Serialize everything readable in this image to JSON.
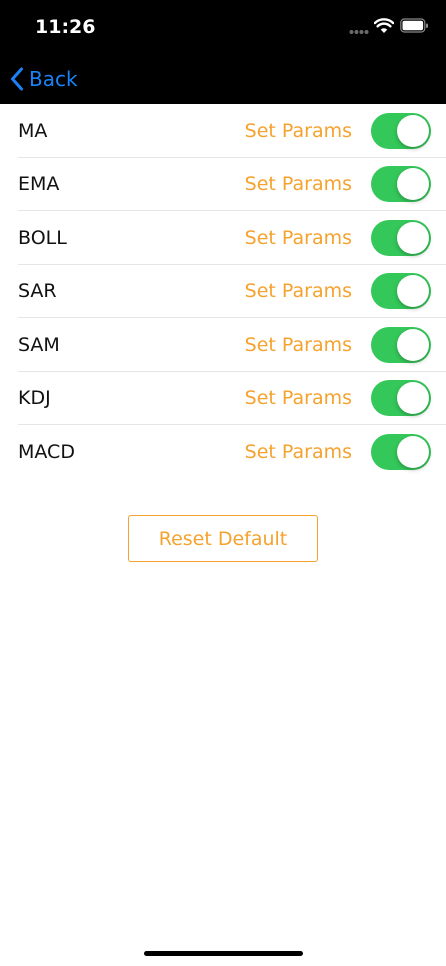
{
  "status_bar": {
    "time": "11:26"
  },
  "nav": {
    "back_label": "Back"
  },
  "indicators": [
    {
      "name": "MA",
      "action": "Set Params",
      "enabled": true
    },
    {
      "name": "EMA",
      "action": "Set Params",
      "enabled": true
    },
    {
      "name": "BOLL",
      "action": "Set Params",
      "enabled": true
    },
    {
      "name": "SAR",
      "action": "Set Params",
      "enabled": true
    },
    {
      "name": "SAM",
      "action": "Set Params",
      "enabled": true
    },
    {
      "name": "KDJ",
      "action": "Set Params",
      "enabled": true
    },
    {
      "name": "MACD",
      "action": "Set Params",
      "enabled": true
    }
  ],
  "reset_button": {
    "label": "Reset Default"
  },
  "colors": {
    "accent": "#f5a22e",
    "toggle_on": "#34c759",
    "back_link": "#1a82f7",
    "nav_background": "#000000"
  }
}
